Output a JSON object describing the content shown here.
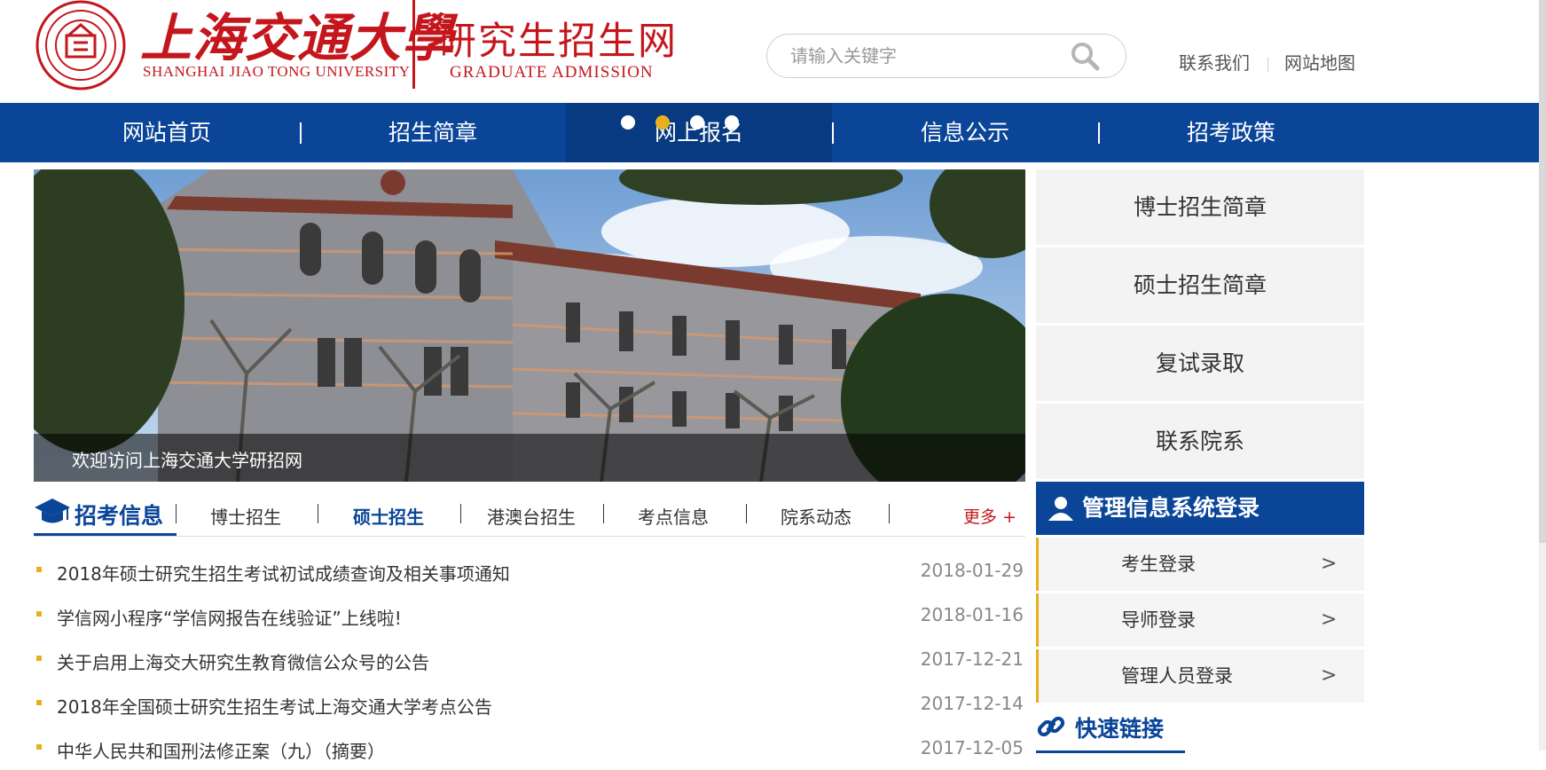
{
  "header": {
    "logo_cn": "上海交通大學",
    "logo_en": "SHANGHAI JIAO TONG UNIVERSITY",
    "site_cn": "研究生招生网",
    "site_en": "GRADUATE ADMISSION",
    "search_placeholder": "请输入关键字",
    "links": [
      "联系我们",
      "网站地图"
    ]
  },
  "nav": {
    "items": [
      "网站首页",
      "招生简章",
      "网上报名",
      "信息公示",
      "招考政策"
    ],
    "active_index": 2
  },
  "banner": {
    "caption": "欢迎访问上海交通大学研招网",
    "slide_count": 4,
    "active_slide": 1
  },
  "side_menu": [
    "博士招生简章",
    "硕士招生简章",
    "复试录取",
    "联系院系"
  ],
  "login": {
    "title": "管理信息系统登录",
    "items": [
      "考生登录",
      "导师登录",
      "管理人员登录"
    ],
    "arrow": ">"
  },
  "quick_links": {
    "title": "快速链接"
  },
  "tabs": {
    "title": "招考信息",
    "items": [
      "博士招生",
      "硕士招生",
      "港澳台招生",
      "考点信息",
      "院系动态"
    ],
    "active_index": 1,
    "more": "更多 +"
  },
  "news": [
    {
      "title": "2018年硕士研究生招生考试初试成绩查询及相关事项通知",
      "date": "2018-01-29"
    },
    {
      "title": "学信网小程序“学信网报告在线验证”上线啦!",
      "date": "2018-01-16"
    },
    {
      "title": "关于启用上海交大研究生教育微信公众号的公告",
      "date": "2017-12-21"
    },
    {
      "title": "2018年全国硕士研究生招生考试上海交通大学考点公告",
      "date": "2017-12-14"
    },
    {
      "title": "中华人民共和国刑法修正案（九）（摘要）",
      "date": "2017-12-05"
    }
  ],
  "colors": {
    "brand_red": "#c4171d",
    "brand_blue": "#0a4598",
    "accent_gold": "#e8b01e"
  }
}
